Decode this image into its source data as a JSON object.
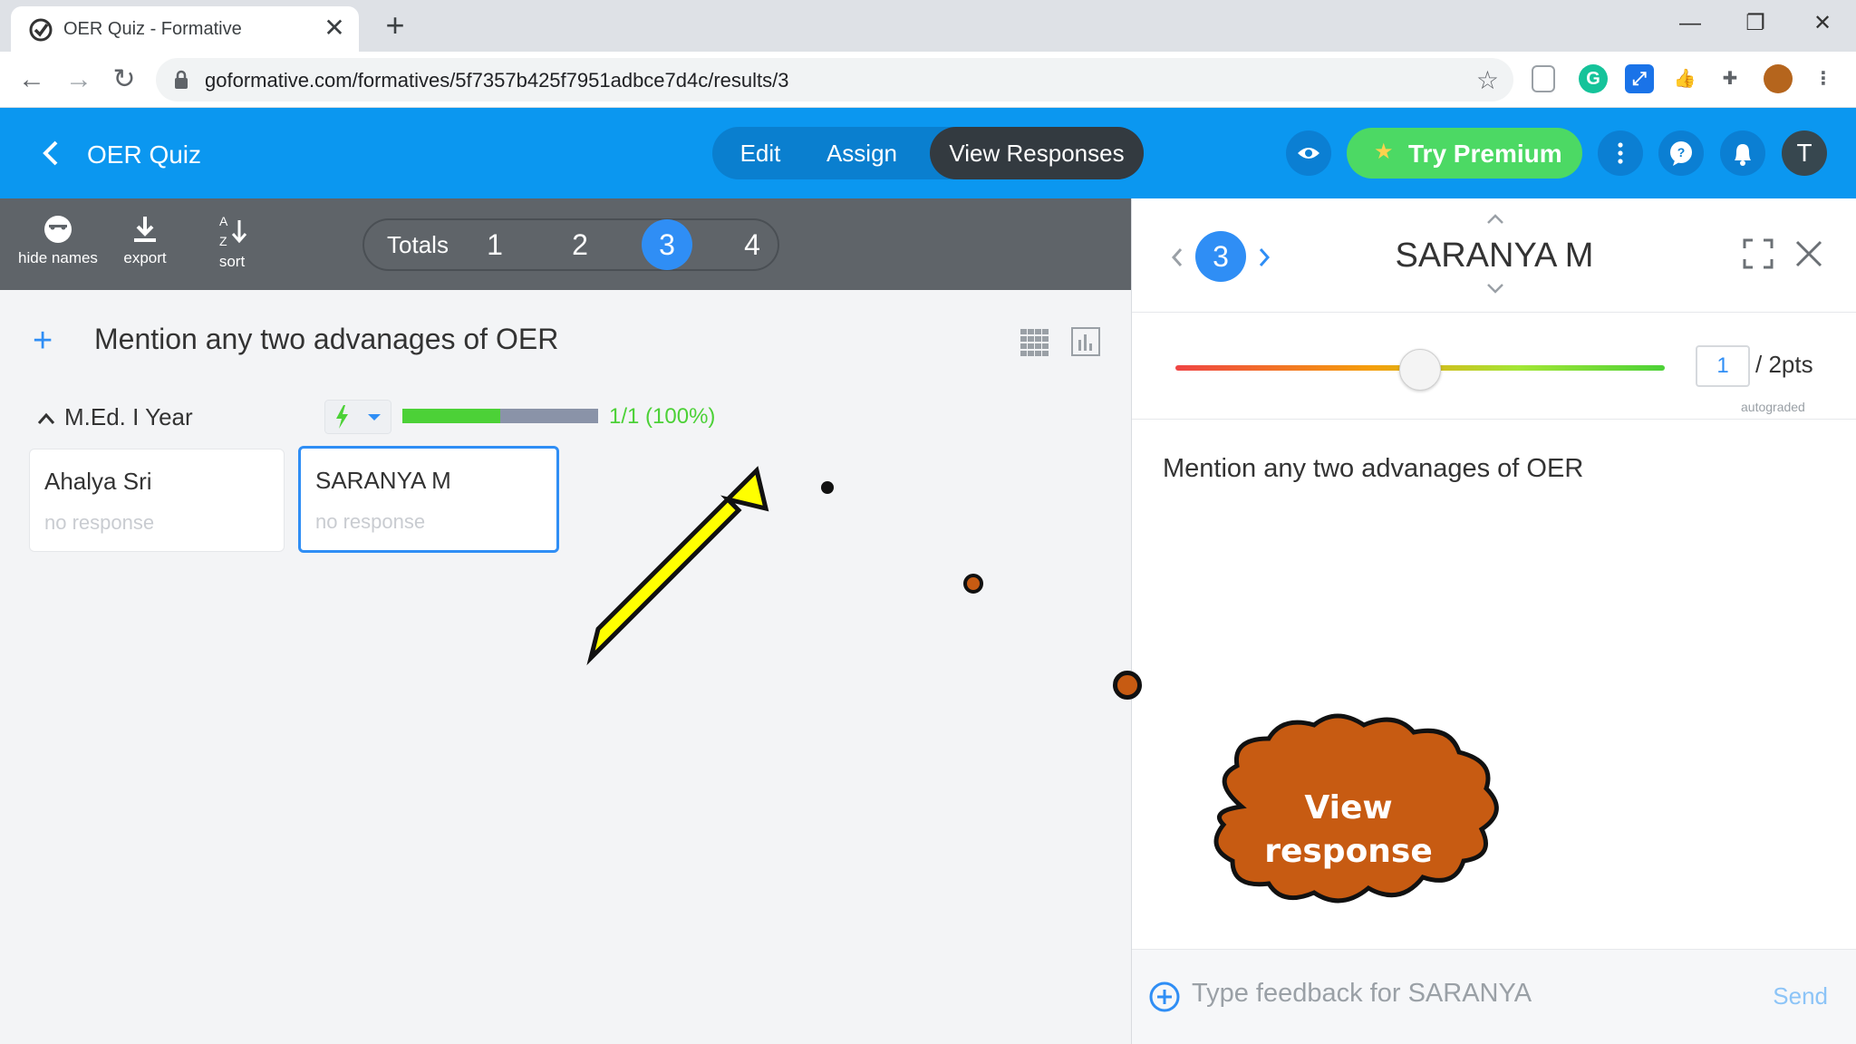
{
  "browser": {
    "tab_title": "OER Quiz - Formative",
    "tab_close": "✕",
    "new_tab": "+",
    "url": "goformative.com/formatives/5f7357b425f7951adbce7d4c/results/3",
    "window": {
      "minimize": "—",
      "restore": "❐",
      "close": "✕"
    },
    "nav": {
      "back": "←",
      "forward": "→",
      "reload": "↻"
    },
    "star": "☆"
  },
  "header": {
    "title": "OER Quiz",
    "tabs": [
      {
        "label": "Edit"
      },
      {
        "label": "Assign"
      },
      {
        "label": "View Responses"
      }
    ],
    "premium_label": "Try Premium",
    "avatar_initial": "T"
  },
  "toolbar": {
    "hide_names": "hide names",
    "export": "export",
    "sort": "sort",
    "sort_a": "A",
    "sort_z": "Z",
    "totals_label": "Totals",
    "pages": [
      "1",
      "2",
      "3",
      "4"
    ],
    "active_page": "3"
  },
  "question": {
    "plus": "+",
    "text": "Mention any two advanages of OER"
  },
  "class_group": {
    "name": "M.Ed. I Year",
    "progress_text": "1/1 (100%)",
    "progress_fraction": 0.5
  },
  "students": [
    {
      "name": "Ahalya Sri",
      "response": "no response"
    },
    {
      "name": "SARANYA M",
      "response": "no response"
    }
  ],
  "detail": {
    "number": "3",
    "student_name": "SARANYA M",
    "score": "1",
    "max_points": "/ 2pts",
    "autograded": "autograded",
    "score_fraction": 0.5,
    "question_text": "Mention any two advanages of OER",
    "feedback_placeholder": "Type feedback for SARANYA",
    "send": "Send"
  },
  "annotation": {
    "cloud_line1": "View",
    "cloud_line2": "response",
    "colors": {
      "arrow": "#ffff00",
      "cloud": "#c75b12"
    }
  }
}
